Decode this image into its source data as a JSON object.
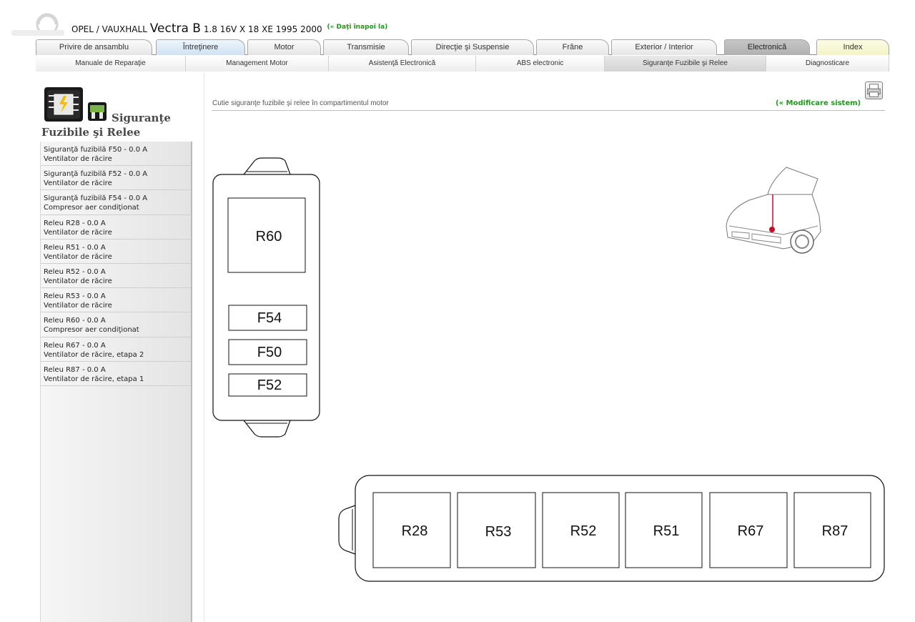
{
  "header": {
    "brand": "OPEL / VAUXHALL",
    "model": "Vectra B",
    "engine": "1.8 16V X 18 XE 1995 2000",
    "back_link": "(« Daţi înapoi la)"
  },
  "main_tabs": [
    {
      "label": "Privire de ansamblu"
    },
    {
      "label": "Întreţinere"
    },
    {
      "label": "Motor"
    },
    {
      "label": "Transmisie"
    },
    {
      "label": "Direcţie şi Suspensie"
    },
    {
      "label": "Frâne"
    },
    {
      "label": "Exterior / Interior"
    },
    {
      "label": "Electronică"
    },
    {
      "label": "Index"
    }
  ],
  "sub_tabs": [
    {
      "label": "Manuale de Reparaţie"
    },
    {
      "label": "Management Motor"
    },
    {
      "label": "Asistenţă Electronică"
    },
    {
      "label": "ABS electronic"
    },
    {
      "label": "Siguranţe Fuzibile şi Relee"
    },
    {
      "label": "Diagnosticare"
    }
  ],
  "sidebar": {
    "title_line1": "Siguranţe",
    "title_line2": "Fuzibile şi Relee",
    "items": [
      {
        "line1": "Siguranţă fuzibilă F50 - 0.0 A",
        "line2": "Ventilator de răcire"
      },
      {
        "line1": "Siguranţă fuzibilă F52 - 0.0 A",
        "line2": "Ventilator de răcire"
      },
      {
        "line1": "Siguranţă fuzibilă F54 - 0.0 A",
        "line2": "Compresor aer condiţionat"
      },
      {
        "line1": "Releu R28 - 0.0 A",
        "line2": "Ventilator de răcire"
      },
      {
        "line1": "Releu R51 - 0.0 A",
        "line2": "Ventilator de răcire"
      },
      {
        "line1": "Releu R52 - 0.0 A",
        "line2": "Ventilator de răcire"
      },
      {
        "line1": "Releu R53 - 0.0 A",
        "line2": "Ventilator de răcire"
      },
      {
        "line1": "Releu R60 - 0.0 A",
        "line2": "Compresor aer condiţionat"
      },
      {
        "line1": "Releu R67 - 0.0 A",
        "line2": "Ventilator de răcire, etapa 2"
      },
      {
        "line1": "Releu R87 - 0.0 A",
        "line2": "Ventilator de răcire, etapa 1"
      }
    ]
  },
  "content": {
    "title": "Cutie siguranţe fuzibile şi relee în compartimentul motor",
    "modify_link": "(« Modificare sistem)"
  },
  "diagram": {
    "left_box": {
      "relay": "R60",
      "fuses": [
        "F54",
        "F50",
        "F52"
      ]
    },
    "bottom_box": {
      "relays": [
        "R28",
        "R53",
        "R52",
        "R51",
        "R67",
        "R87"
      ]
    }
  },
  "icons": {
    "logo": "autodata-logo-watermark",
    "section": "fuse-relay-diagram-icon",
    "chip": "relay-chip-icon",
    "print": "print-icon",
    "car": "car-location-icon"
  },
  "colors": {
    "link_green": "#1c9a18",
    "active_tab": "#bcbcbc",
    "highlight_tab": "#d6e6f5",
    "index_tab": "#f7f7d2",
    "location_marker": "#c0102c"
  }
}
